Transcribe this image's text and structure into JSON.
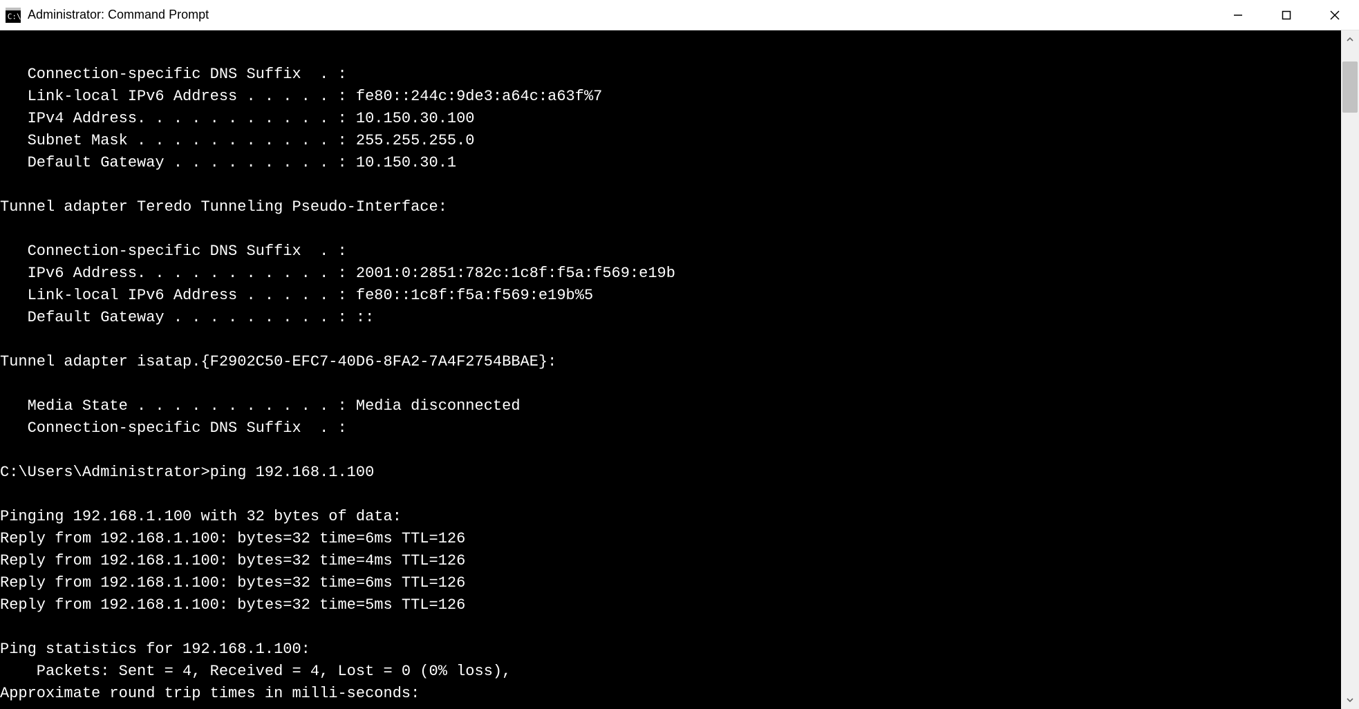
{
  "window": {
    "title": "Administrator: Command Prompt"
  },
  "scrollbar": {
    "thumb_top_pct": 2,
    "thumb_height_pct": 8
  },
  "terminal": {
    "lines": [
      "",
      "   Connection-specific DNS Suffix  . :",
      "   Link-local IPv6 Address . . . . . : fe80::244c:9de3:a64c:a63f%7",
      "   IPv4 Address. . . . . . . . . . . : 10.150.30.100",
      "   Subnet Mask . . . . . . . . . . . : 255.255.255.0",
      "   Default Gateway . . . . . . . . . : 10.150.30.1",
      "",
      "Tunnel adapter Teredo Tunneling Pseudo-Interface:",
      "",
      "   Connection-specific DNS Suffix  . :",
      "   IPv6 Address. . . . . . . . . . . : 2001:0:2851:782c:1c8f:f5a:f569:e19b",
      "   Link-local IPv6 Address . . . . . : fe80::1c8f:f5a:f569:e19b%5",
      "   Default Gateway . . . . . . . . . : ::",
      "",
      "Tunnel adapter isatap.{F2902C50-EFC7-40D6-8FA2-7A4F2754BBAE}:",
      "",
      "   Media State . . . . . . . . . . . : Media disconnected",
      "   Connection-specific DNS Suffix  . :",
      "",
      "C:\\Users\\Administrator>ping 192.168.1.100",
      "",
      "Pinging 192.168.1.100 with 32 bytes of data:",
      "Reply from 192.168.1.100: bytes=32 time=6ms TTL=126",
      "Reply from 192.168.1.100: bytes=32 time=4ms TTL=126",
      "Reply from 192.168.1.100: bytes=32 time=6ms TTL=126",
      "Reply from 192.168.1.100: bytes=32 time=5ms TTL=126",
      "",
      "Ping statistics for 192.168.1.100:",
      "    Packets: Sent = 4, Received = 4, Lost = 0 (0% loss),",
      "Approximate round trip times in milli-seconds:"
    ]
  }
}
